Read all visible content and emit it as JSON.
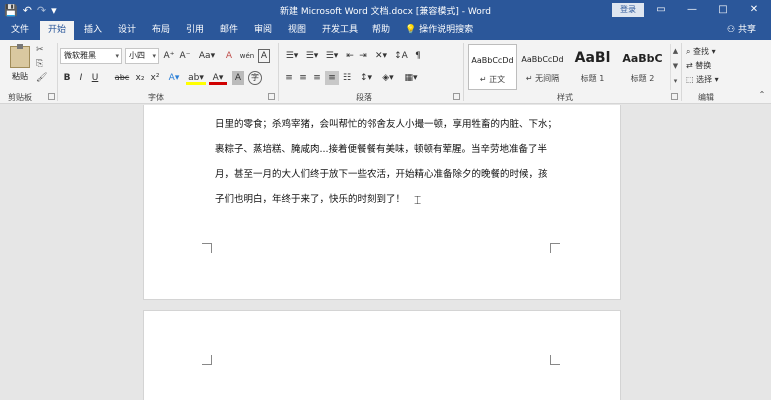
{
  "window": {
    "title": "新建 Microsoft Word 文档.docx [兼容模式] - Word",
    "login_label": "登录",
    "qat": {
      "save": "💾",
      "undo": "↶",
      "redo": "↷",
      "customize": "▾"
    },
    "controls": {
      "restore": "▭",
      "minimize": "—",
      "maximize": "□",
      "close": "✕"
    }
  },
  "tabs": [
    {
      "label": "文件"
    },
    {
      "label": "开始"
    },
    {
      "label": "插入"
    },
    {
      "label": "设计"
    },
    {
      "label": "布局"
    },
    {
      "label": "引用"
    },
    {
      "label": "邮件"
    },
    {
      "label": "审阅"
    },
    {
      "label": "视图"
    },
    {
      "label": "开发工具"
    },
    {
      "label": "帮助"
    }
  ],
  "tell_me": "操作说明搜索",
  "share": "共享",
  "ribbon": {
    "clipboard": {
      "paste": "粘贴",
      "label": "剪贴板"
    },
    "font": {
      "font_name": "微软雅黑",
      "font_size": "小四",
      "label": "字体",
      "buttons": {
        "grow": "A⁺",
        "shrink": "A⁻",
        "case": "Aa▾",
        "clear": "A",
        "phonetic": "wén",
        "border_char": "A",
        "bold": "B",
        "italic": "I",
        "underline": "U",
        "strike": "abc",
        "sub": "x₂",
        "sup": "x²",
        "effects": "A▾",
        "highlight": "ab▾",
        "color": "A▾",
        "shade": "A",
        "enclose": "字"
      }
    },
    "paragraph": {
      "label": "段落",
      "row1": [
        "☰▾",
        "☰▾",
        "☰▾",
        "⇤",
        "⇥",
        "✕▾",
        "↕A",
        "¶"
      ],
      "row2": [
        "≡",
        "≡",
        "≡",
        "≡",
        "☷",
        "↕▾",
        "◈▾",
        "▦▾"
      ]
    },
    "styles": {
      "label": "样式",
      "items": [
        {
          "sample": "AaBbCcDd",
          "name": "↵ 正文"
        },
        {
          "sample": "AaBbCcDd",
          "name": "↵ 无间隔"
        },
        {
          "sample": "AaBl",
          "name": "标题 1"
        },
        {
          "sample": "AaBbC",
          "name": "标题 2"
        }
      ],
      "arrows": [
        "▲",
        "▼",
        "▾"
      ]
    },
    "editing": {
      "label": "编辑",
      "find": "查找 ▾",
      "replace": "替换",
      "select": "选择 ▾"
    }
  },
  "document": {
    "lines": [
      "日里的零食；杀鸡宰猪，会叫帮忙的邻舍友人小撮一顿，享用牲畜的内脏、下水；",
      "裹粽子、蒸培糕、腌咸肉...接着便餐餐有美味，顿顿有荤腥。当辛劳地准备了半",
      "月，甚至一月的大人们终于放下一些农活，开始精心准备除夕的晚餐的时候，孩",
      "子们也明白，年终于来了，快乐的时刻到了！"
    ]
  },
  "colors": {
    "accent": "#2b579a",
    "ribbon_bg": "#f3f3f3",
    "canvas_bg": "#e6e6e6",
    "highlight_color": "#ffff00",
    "font_color": "#d00000",
    "text_effects_color": "#2b7fd7"
  }
}
